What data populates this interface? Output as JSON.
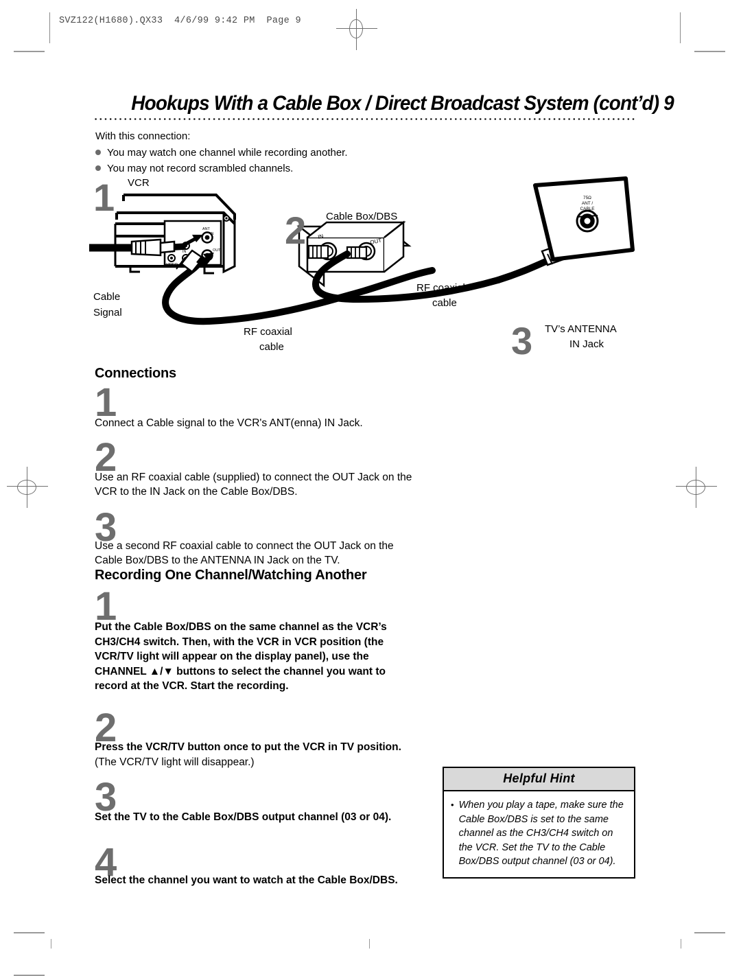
{
  "print_slug": {
    "text": "SVZ122(H1680).QX33  4/6/99 9:42 PM  Page 9"
  },
  "header": {
    "title": "Hookups With a Cable Box / Direct Broadcast System (cont’d)  9"
  },
  "intro": {
    "lead": "With this connection:",
    "bullets": [
      "You may watch one channel while recording another.",
      "You may not record scrambled channels."
    ]
  },
  "diagram": {
    "numbers": {
      "one": "1",
      "two": "2",
      "three": "3"
    },
    "labels": {
      "vcr": "VCR",
      "cable_box": "Cable Box/DBS",
      "cable_signal_line1": "Cable",
      "cable_signal_line2": "Signal",
      "rf_left_line1": "RF coaxial",
      "rf_left_line2": "cable",
      "rf_right_line1": "RF coaxial",
      "rf_right_line2": "cable",
      "tv_jack_line1": "TV’s ANTENNA",
      "tv_jack_line2": "IN Jack"
    },
    "vcr_panel": {
      "ant": "ANT",
      "ant_in": "IN",
      "out": "OUT",
      "video": "VIDEO",
      "audio": "AUDIO",
      "audio_out": "OUT",
      "audio_in": "IN"
    },
    "cable_box_jacks": {
      "in": "IN",
      "out": "OUT"
    },
    "tv_jack_plate": {
      "line1": "75Ω",
      "line2": "ANT /",
      "line3": "CABLE"
    }
  },
  "connections": {
    "heading": "Connections",
    "steps": [
      {
        "number": "1",
        "text": "Connect a Cable signal to the VCR's ANT(enna) IN Jack."
      },
      {
        "number": "2",
        "text": "Use an RF coaxial cable (supplied) to connect the OUT Jack on the VCR to the IN Jack on the Cable Box/DBS."
      },
      {
        "number": "3",
        "text": "Use a second RF coaxial cable to connect the OUT Jack on the Cable Box/DBS to the ANTENNA IN Jack on the TV."
      }
    ]
  },
  "recording": {
    "heading": "Recording One Channel/Watching Another",
    "steps": [
      {
        "number": "1",
        "text": "Put the Cable Box/DBS on the same channel as the VCR’s CH3/CH4 switch. Then, with the VCR in VCR position (the VCR/TV light will appear on the display panel), use the CHANNEL ▲/▼ buttons to select the channel you want to record at the VCR.  Start the recording."
      },
      {
        "number": "2",
        "bold_text": "Press the VCR/TV button once to put the VCR in TV position.",
        "regular_text": " (The VCR/TV light will disappear.)"
      },
      {
        "number": "3",
        "text": "Set the TV to the Cable Box/DBS output channel (03 or 04)."
      },
      {
        "number": "4",
        "text": "Select the channel you want to watch at the Cable Box/DBS."
      }
    ]
  },
  "helpful_hint": {
    "title": "Helpful Hint",
    "bullet": "•",
    "text": "When you play a tape, make sure the Cable Box/DBS is set to the same channel as the CH3/CH4 switch on the VCR. Set the TV to the Cable Box/DBS output channel (03 or 04)."
  }
}
